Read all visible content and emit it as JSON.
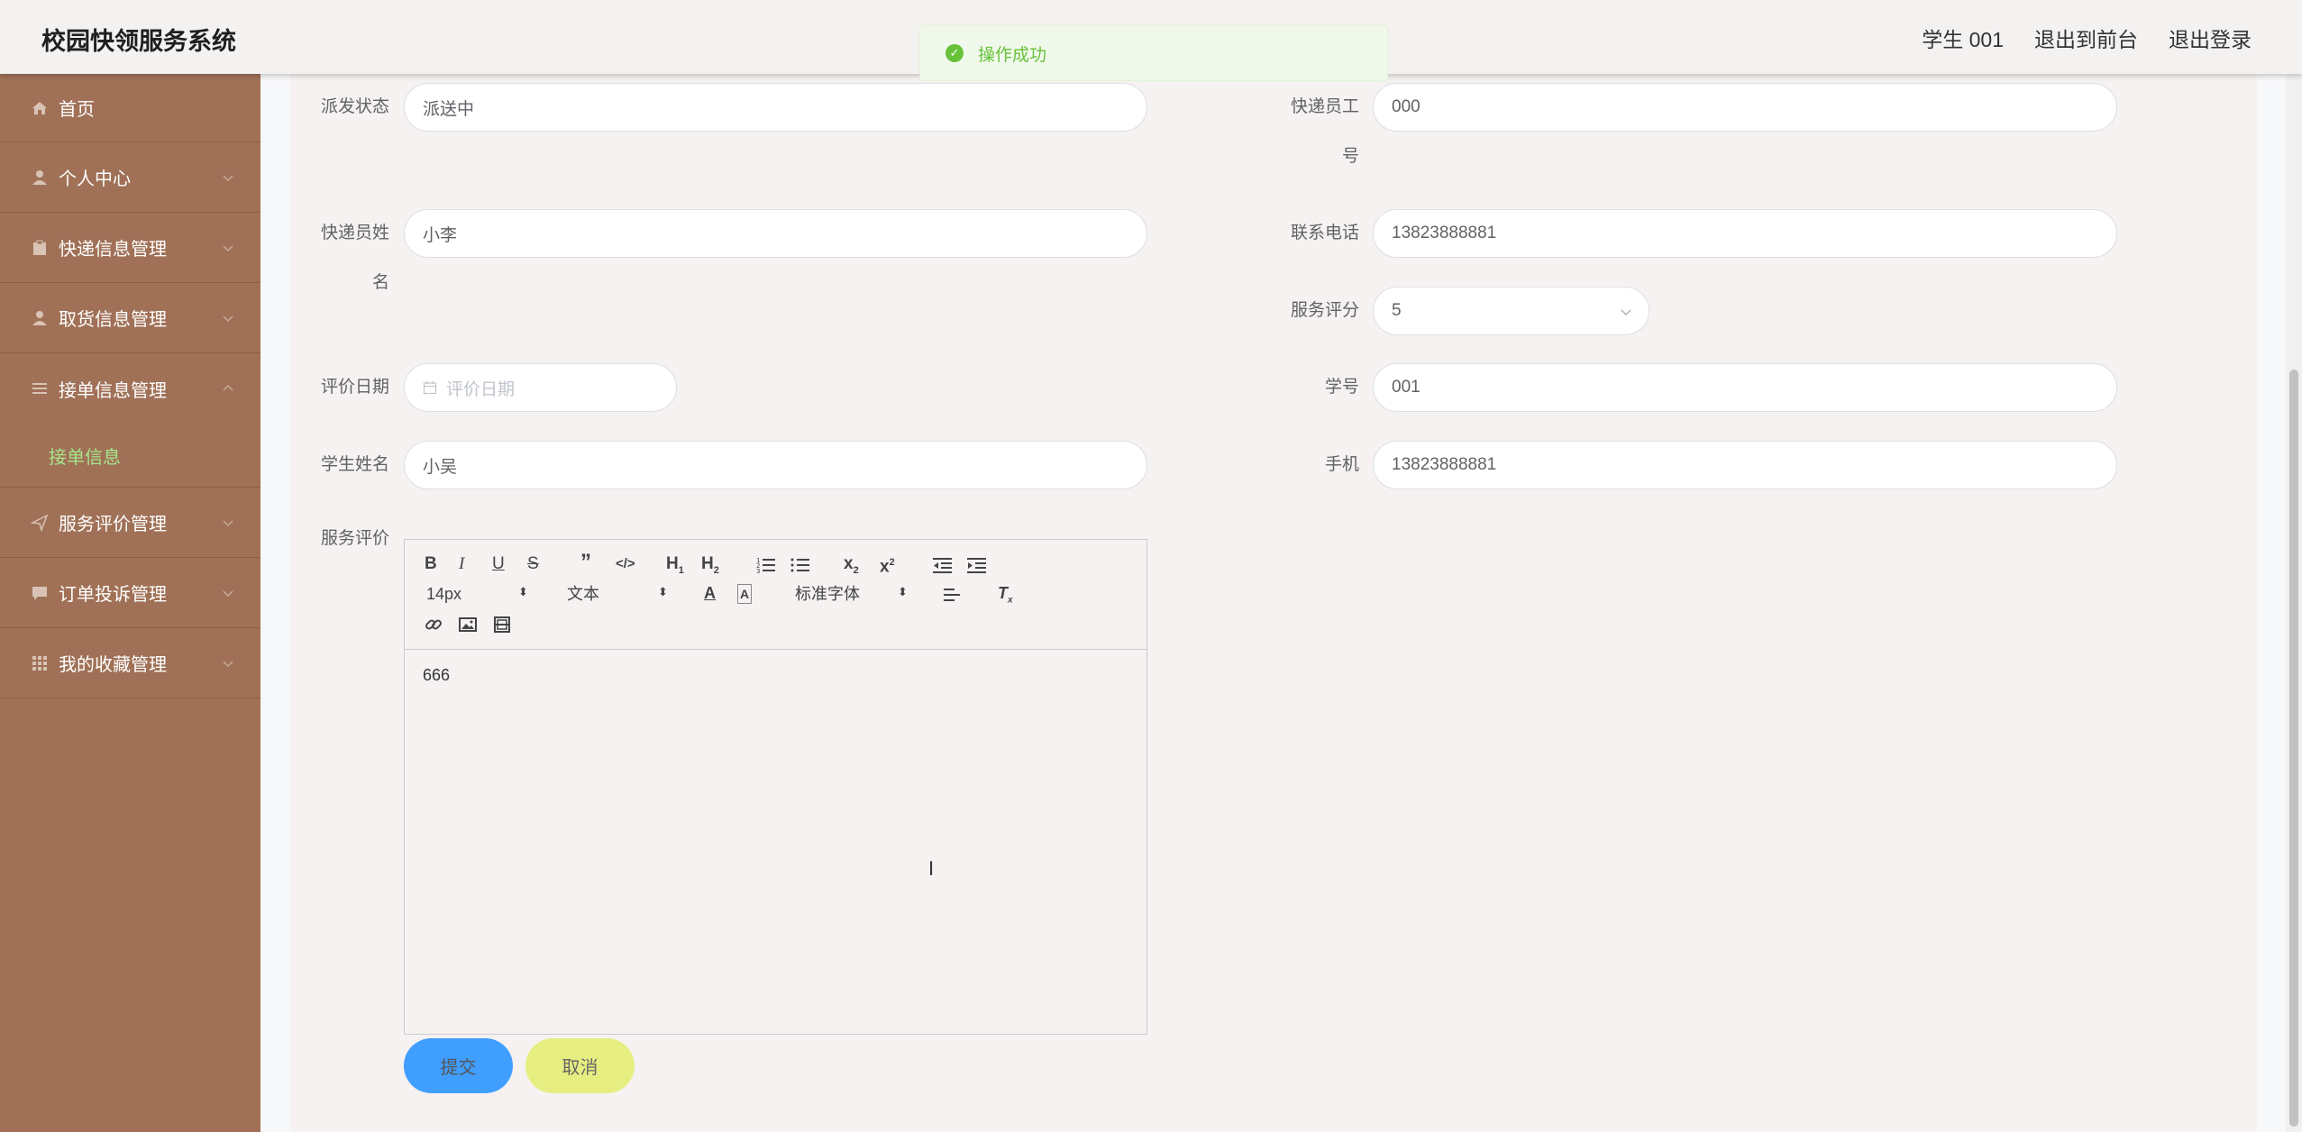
{
  "header": {
    "title": "校园快领服务系统",
    "user": "学生 001",
    "to_front": "退出到前台",
    "logout": "退出登录"
  },
  "toast": {
    "message": "操作成功"
  },
  "sidebar": {
    "items": [
      {
        "label": "首页",
        "icon": "home-icon"
      },
      {
        "label": "个人中心",
        "icon": "user-icon"
      },
      {
        "label": "快递信息管理",
        "icon": "clipboard-icon"
      },
      {
        "label": "取货信息管理",
        "icon": "user-icon"
      },
      {
        "label": "接单信息管理",
        "icon": "list-icon"
      },
      {
        "label": "服务评价管理",
        "icon": "send-icon"
      },
      {
        "label": "订单投诉管理",
        "icon": "chat-icon"
      },
      {
        "label": "我的收藏管理",
        "icon": "grid-icon"
      }
    ],
    "sub_active": "接单信息",
    "accent_color": "#a6e58a",
    "bg_color": "#a07157"
  },
  "form": {
    "dispatch_status": {
      "label": "派发状态",
      "value": "派送中"
    },
    "courier_id": {
      "label_a": "快递员工",
      "label_b": "号",
      "value": "000"
    },
    "courier_name": {
      "label_a": "快递员姓",
      "label_b": "名",
      "value": "小李"
    },
    "contact_phone": {
      "label": "联系电话",
      "value": "13823888881"
    },
    "service_score": {
      "label": "服务评分",
      "value": "5"
    },
    "eval_date": {
      "label": "评价日期",
      "placeholder": "评价日期"
    },
    "student_no": {
      "label": "学号",
      "value": "001"
    },
    "student_name": {
      "label": "学生姓名",
      "value": "小吴"
    },
    "mobile": {
      "label": "手机",
      "value": "13823888881"
    },
    "service_eval": {
      "label": "服务评价",
      "content": "666"
    }
  },
  "editor": {
    "font_size": "14px",
    "block_type": "文本",
    "font_family": "标准字体"
  },
  "buttons": {
    "submit": "提交",
    "cancel": "取消"
  }
}
